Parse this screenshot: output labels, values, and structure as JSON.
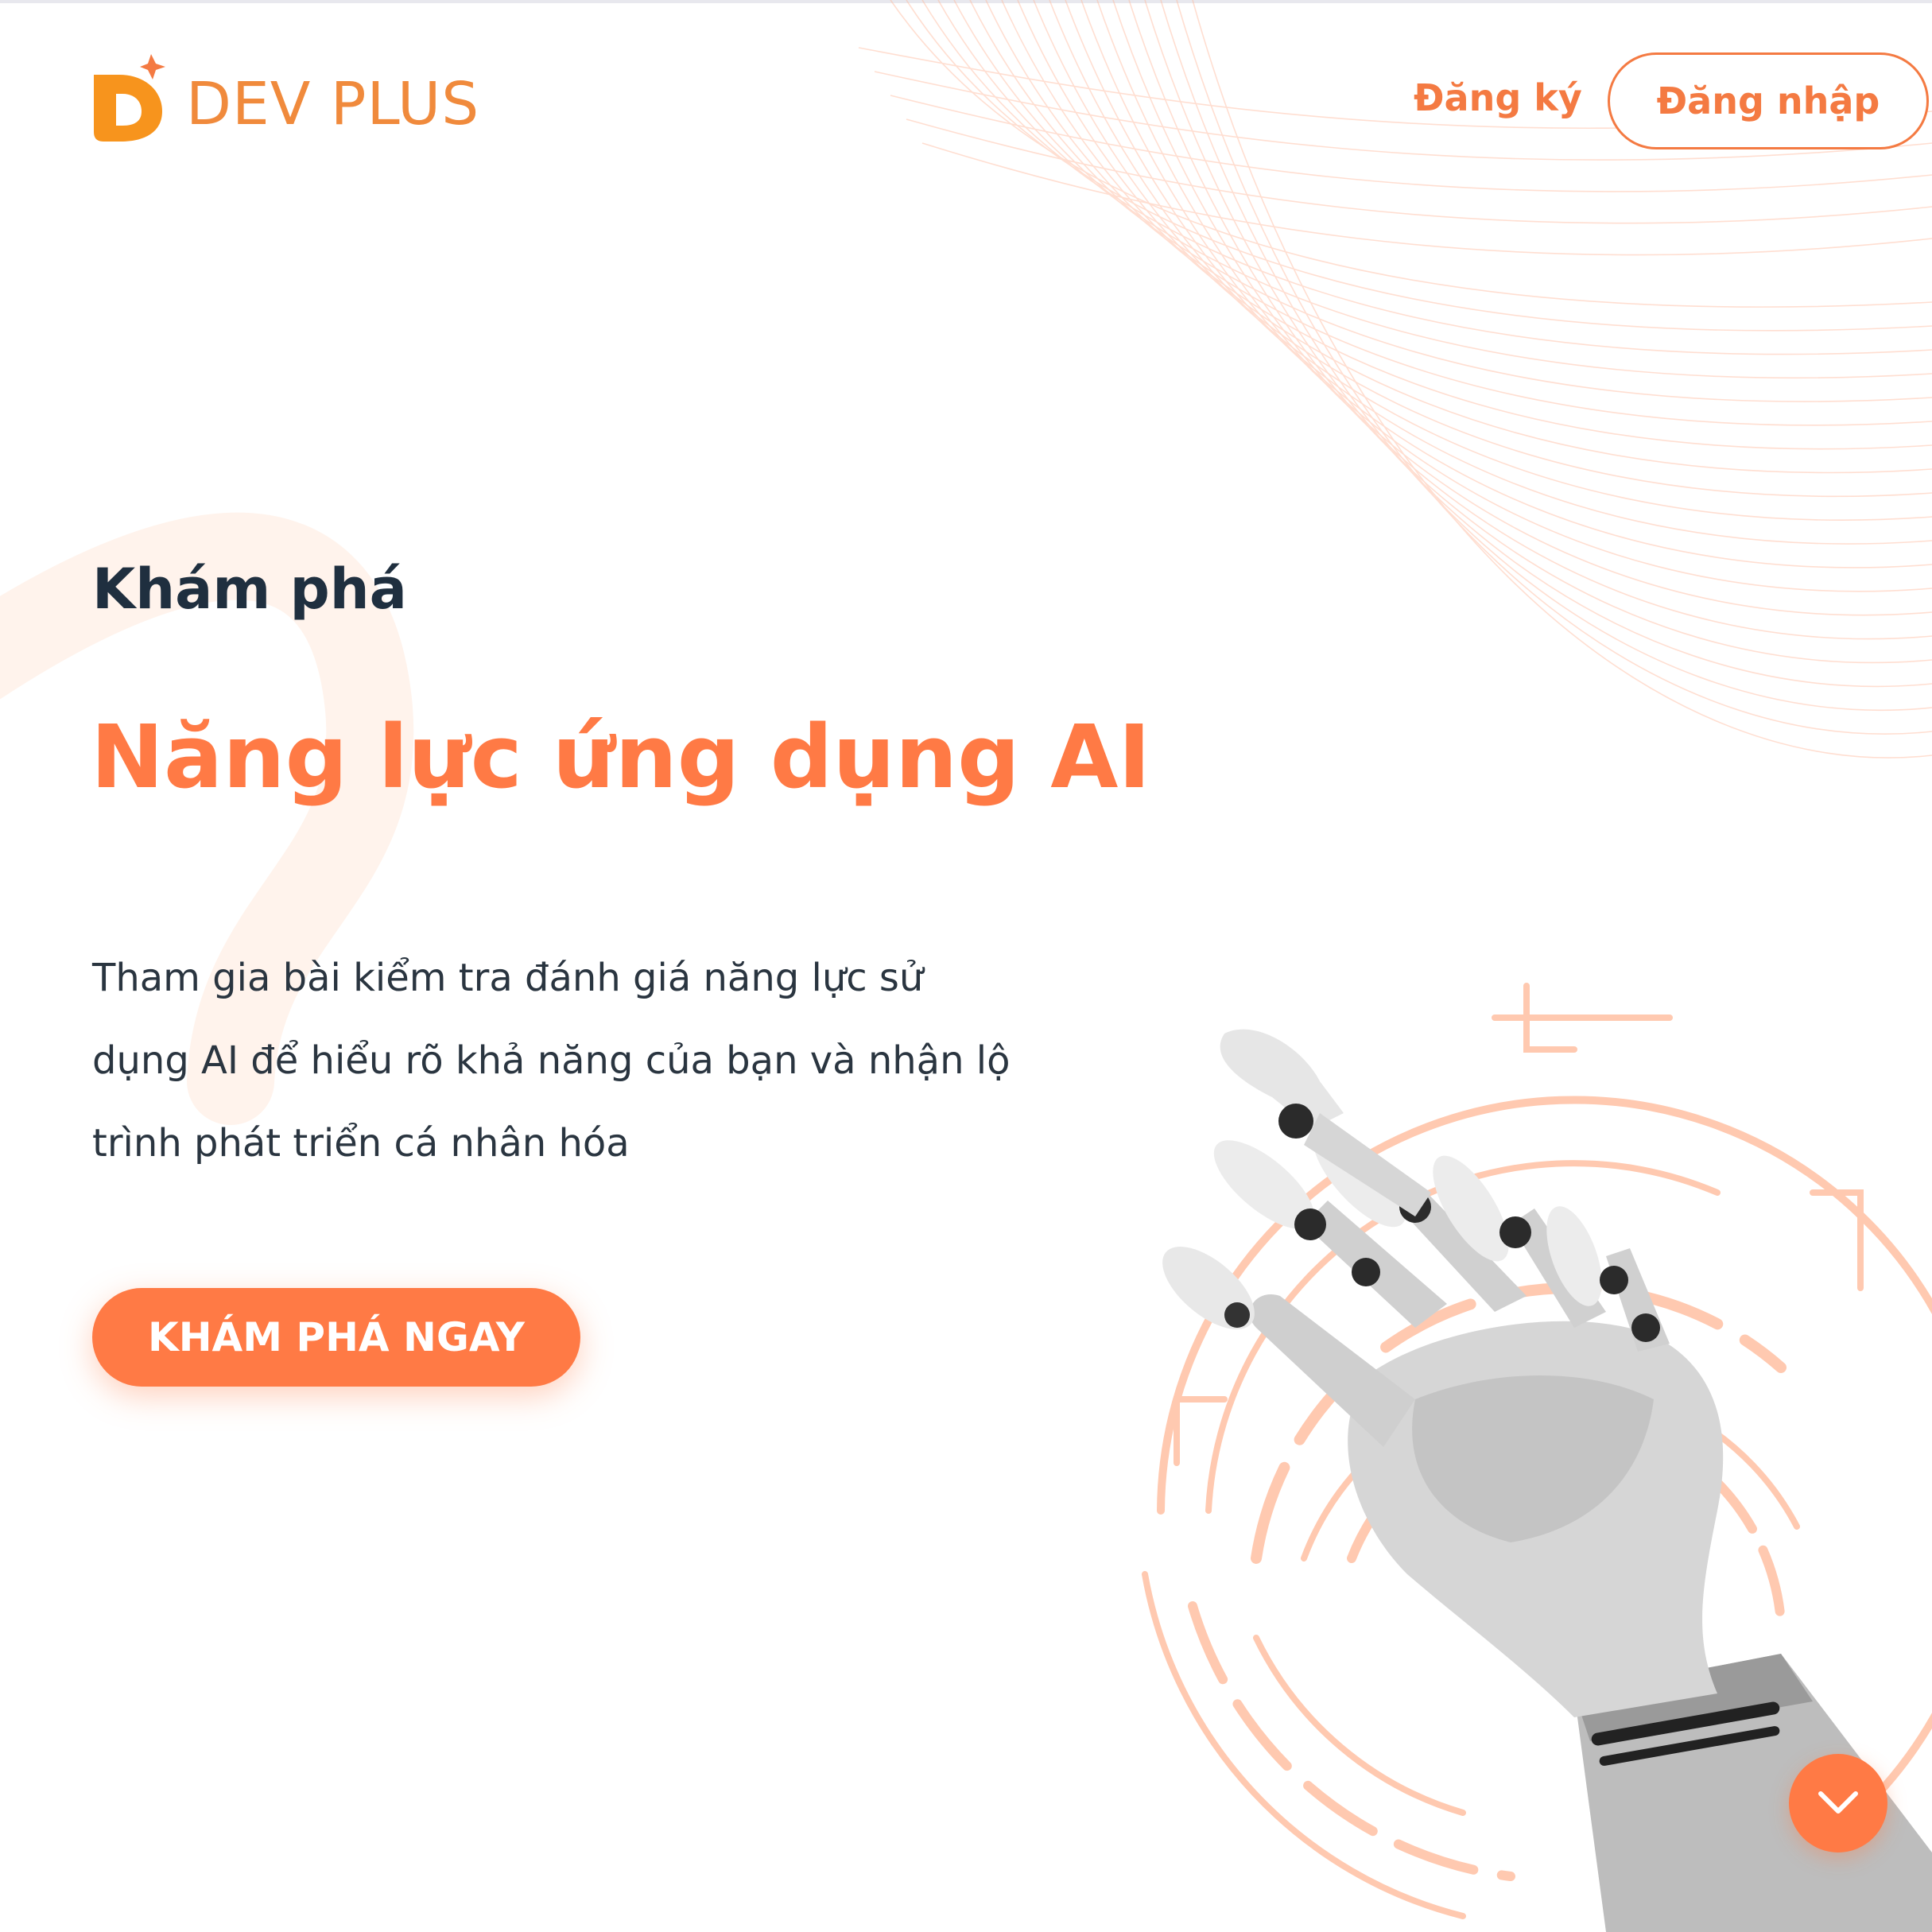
{
  "brand": {
    "name": "DEV PLUS",
    "accent_color": "#ff7a45"
  },
  "header": {
    "signup_label": "Đăng ký",
    "login_label": "Đăng nhập"
  },
  "hero": {
    "eyebrow": "Khám phá",
    "title": "Năng lực ứng dụng AI",
    "description": "Tham gia bài kiểm tra đánh giá năng lực sử dụng AI để hiểu rõ khả năng của bạn và nhận lộ trình phát triển cá nhân hóa",
    "cta_label": "KHÁM PHÁ NGAY"
  },
  "icons": {
    "logo": "dev-plus-logo-icon",
    "scroll": "chevron-down-icon",
    "illustration": "robot-hand-illustration"
  }
}
